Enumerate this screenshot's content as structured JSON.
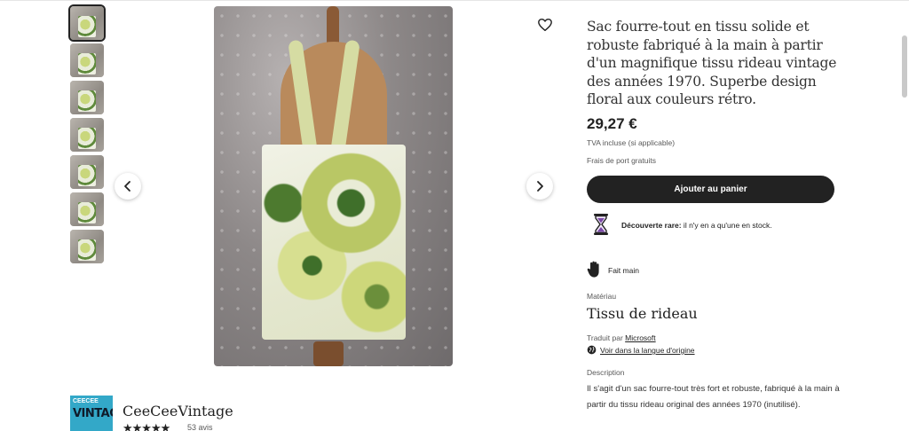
{
  "gallery": {
    "thumbnails": [
      {
        "label": "thumbnail 1",
        "active": true
      },
      {
        "label": "thumbnail 2",
        "active": false
      },
      {
        "label": "thumbnail 3",
        "active": false
      },
      {
        "label": "thumbnail 4",
        "active": false
      },
      {
        "label": "thumbnail 5",
        "active": false
      },
      {
        "label": "thumbnail 6",
        "active": false
      },
      {
        "label": "thumbnail 7",
        "active": false
      }
    ],
    "prev_icon": "chevron-left-icon",
    "next_icon": "chevron-right-icon",
    "favorite_icon": "heart-icon"
  },
  "shop": {
    "logo_line1": "CEECEE",
    "logo_line2": "VINTAGE",
    "name": "CeeCeeVintage",
    "stars": "★★★★★",
    "rating": 5,
    "reviews": "53 avis"
  },
  "product": {
    "title": "Sac fourre-tout en tissu solide et robuste fabriqué à la main à partir d'un magnifique tissu rideau vintage des années 1970. Superbe design floral aux couleurs rétro.",
    "price": "29,27 €",
    "vat": "TVA incluse (si applicable)",
    "shipping": "Frais de port gratuits",
    "cart_button": "Ajouter au panier",
    "rare_bold": "Découverte rare:",
    "rare_text": " il n'y en a qu'une en stock.",
    "handmade": "Fait main",
    "material_label": "Matériau",
    "material_value": "Tissu de rideau",
    "translated_prefix": "Traduit par ",
    "translated_by": "Microsoft",
    "original_language": "Voir dans la langue d'origine",
    "description_label": "Description",
    "description": "Il s'agit d'un sac fourre-tout très fort et robuste, fabriqué à la main à partir du tissu rideau original des années 1970 (inutilisé)."
  },
  "colors": {
    "button_bg": "#222222",
    "shop_logo_bg": "#33a8c8",
    "hourglass": "#7b4aa8"
  }
}
